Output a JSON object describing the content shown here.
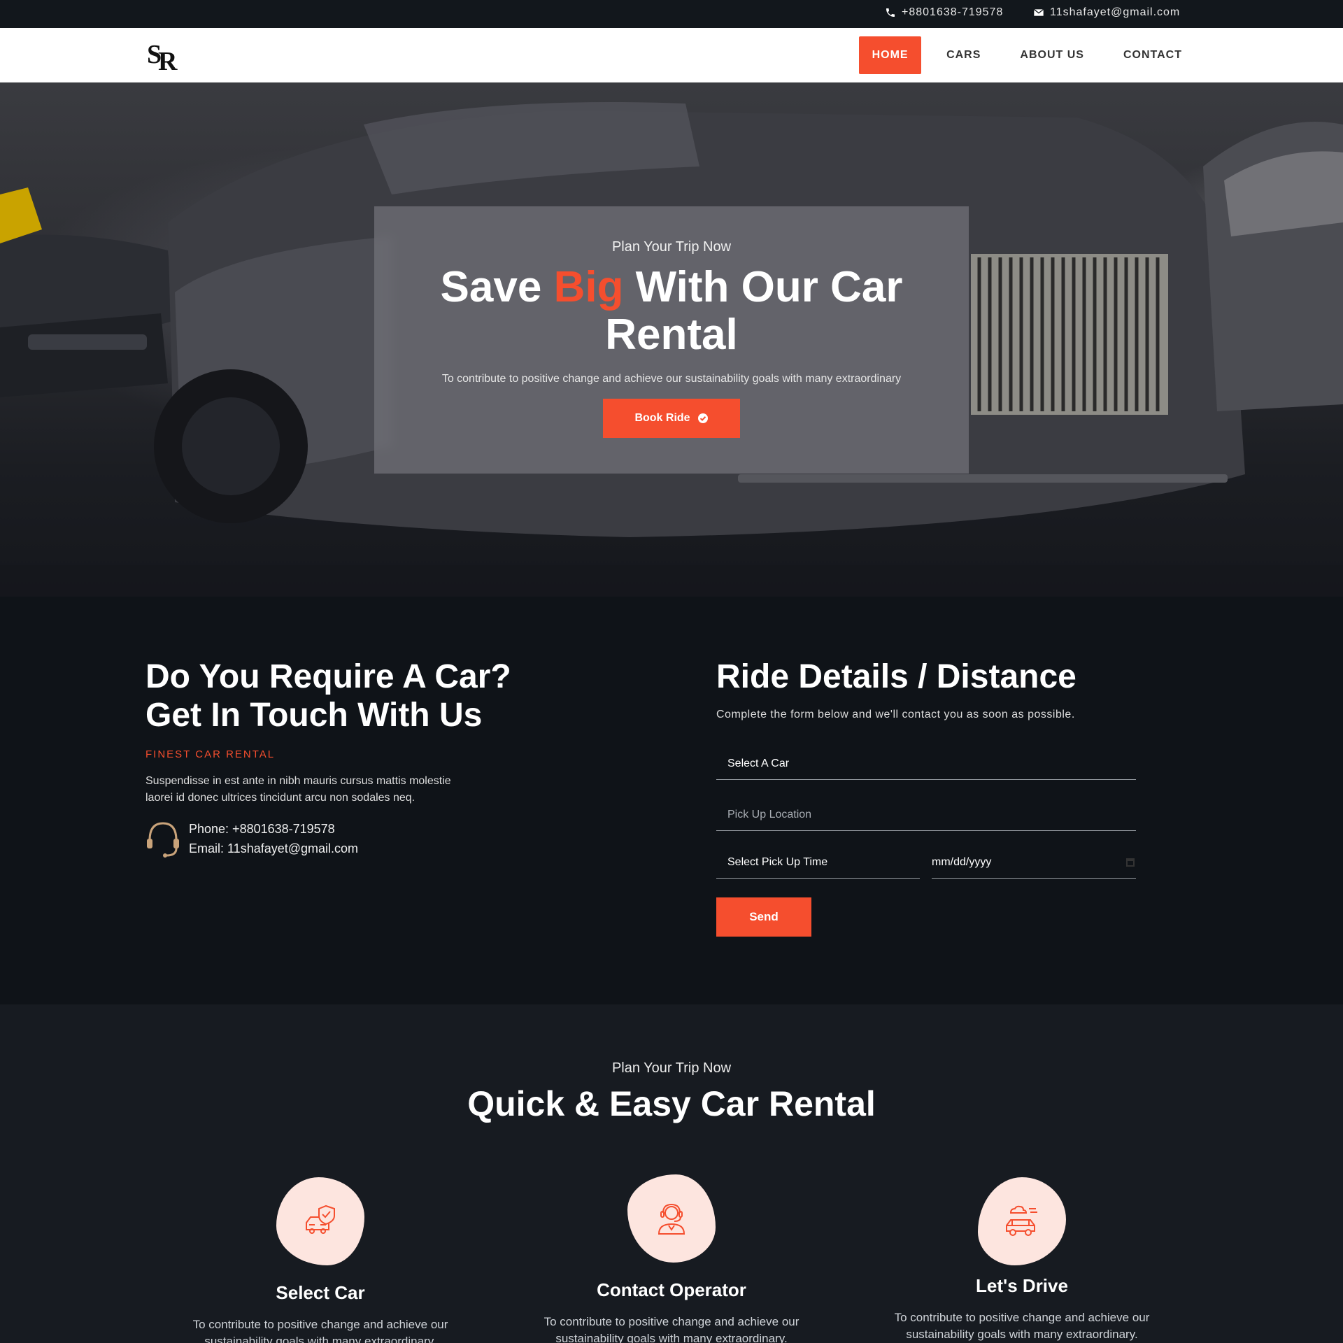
{
  "topbar": {
    "phone": "+8801638-719578",
    "email": "11shafayet@gmail.com"
  },
  "nav": {
    "logo": "SR",
    "items": [
      {
        "label": "HOME",
        "active": true
      },
      {
        "label": "CARS"
      },
      {
        "label": "ABOUT US"
      },
      {
        "label": "CONTACT"
      }
    ]
  },
  "hero": {
    "kicker": "Plan Your Trip Now",
    "title_pre": "Save ",
    "title_highlight": "Big",
    "title_post": " With Our Car Rental",
    "description": "To contribute to positive change and achieve our sustainability goals with many extraordinary",
    "button_label": "Book Ride"
  },
  "touch": {
    "heading_line1": "Do You Require A Car?",
    "heading_line2": "Get In Touch With Us",
    "tagline": "FINEST CAR RENTAL",
    "paragraph": "Suspendisse in est ante in nibh mauris cursus mattis molestie laorei id donec ultrices tincidunt arcu non sodales neq.",
    "phone_line": "Phone: +8801638-719578",
    "email_line": "Email: 11shafayet@gmail.com"
  },
  "form": {
    "heading": "Ride Details / Distance",
    "subtitle": "Complete the form below and we'll contact you as soon as possible.",
    "car_select": "Select A Car",
    "location_placeholder": "Pick Up Location",
    "time_select": "Select Pick Up Time",
    "date_placeholder": "mm/dd/yyyy",
    "send_label": "Send"
  },
  "steps": {
    "kicker": "Plan Your Trip Now",
    "title": "Quick & Easy Car Rental",
    "items": [
      {
        "title": "Select Car",
        "text": "To contribute to positive change and achieve our sustainability goals with many extraordinary.",
        "icon": "car-shield-icon"
      },
      {
        "title": "Contact Operator",
        "text": "To contribute to positive change and achieve our sustainability goals with many extraordinary.",
        "icon": "operator-icon"
      },
      {
        "title": "Let's Drive",
        "text": "To contribute to positive change and achieve our sustainability goals with many extraordinary.",
        "icon": "driving-car-icon"
      }
    ]
  },
  "colors": {
    "accent": "#f54e2e",
    "dark": "#0f1318",
    "icon_bg": "#fde5df"
  }
}
